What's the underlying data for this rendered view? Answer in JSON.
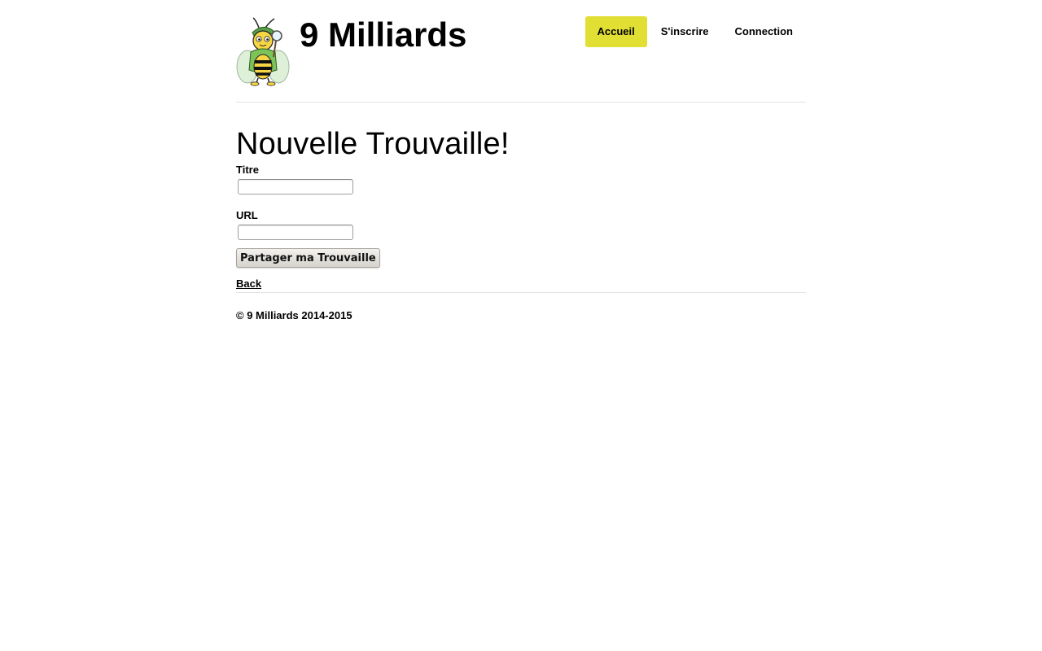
{
  "header": {
    "brand": "9 Milliards",
    "logo_icon": "bee-detective-logo",
    "nav": [
      {
        "label": "Accueil",
        "active": true
      },
      {
        "label": "S'inscrire",
        "active": false
      },
      {
        "label": "Connection",
        "active": false
      }
    ],
    "accent_color": "#e1df33"
  },
  "main": {
    "title": "Nouvelle Trouvaille!",
    "fields": [
      {
        "label": "Titre",
        "value": ""
      },
      {
        "label": "URL",
        "value": ""
      }
    ],
    "submit_label": "Partager ma Trouvaille",
    "back_label": "Back"
  },
  "footer": {
    "copyright": "© 9 Milliards 2014-2015"
  }
}
